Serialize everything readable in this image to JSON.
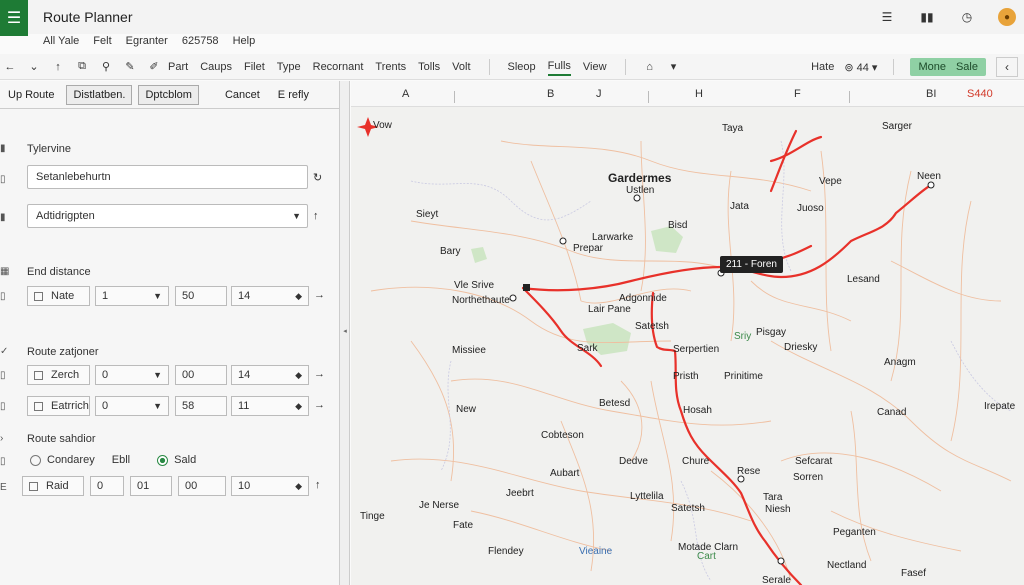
{
  "app": {
    "title": "Route Planner",
    "menu_icon": "hamburger-icon"
  },
  "menubar": [
    "All Yale",
    "Felt",
    "Egranter",
    "625758",
    "Help"
  ],
  "toolbar": {
    "labels": [
      "Part",
      "Caups",
      "Filet",
      "Type",
      "Recornant",
      "Trents",
      "Tolls",
      "Volt"
    ],
    "labels2": [
      "Sleop",
      "Fulls",
      "View"
    ],
    "active": "Fulls",
    "hate": "Hate",
    "zoom": "44",
    "green_label_1": "Mone",
    "green_label_2": "Sale"
  },
  "left": {
    "tabs": [
      "Up Route",
      "Distlatben.",
      "Dptcblom",
      "Cancet",
      "E refly"
    ],
    "section1": "Tylervine",
    "field1": "Setanlebehurtn",
    "field2": "Adtidrigpten",
    "section2": "End distance",
    "row1": {
      "label": "Nate",
      "v1": "1",
      "v2": "50",
      "v3": "14"
    },
    "section3": "Route zatjoner",
    "row2": {
      "label": "Zerch",
      "v1": "0",
      "v2": "00",
      "v3": "14"
    },
    "row3": {
      "label": "Eatrrich",
      "v1": "0",
      "v2": "58",
      "v3": "11"
    },
    "section4": "Route sahdior",
    "radio1": "Condarey",
    "radio_mid": "Ebll",
    "radio2": "Sald",
    "row4": {
      "label": "Raid",
      "v1": "0",
      "v2": "01",
      "v3": "00",
      "v4": "10"
    }
  },
  "map": {
    "columns": [
      "A",
      "B",
      "J",
      "H",
      "F",
      "BI"
    ],
    "price": "S440",
    "tooltip": "211 - Foren",
    "places": [
      {
        "t": "Vow",
        "c": ""
      },
      {
        "t": "Taya",
        "c": ""
      },
      {
        "t": "Sarger",
        "c": ""
      },
      {
        "t": "Gardermes",
        "c": "big"
      },
      {
        "t": "Ustlen",
        "c": ""
      },
      {
        "t": "Jata",
        "c": ""
      },
      {
        "t": "Vepe",
        "c": ""
      },
      {
        "t": "Juoso",
        "c": ""
      },
      {
        "t": "Neen",
        "c": ""
      },
      {
        "t": "Sieyt",
        "c": ""
      },
      {
        "t": "Bisd",
        "c": ""
      },
      {
        "t": "Larwarke",
        "c": ""
      },
      {
        "t": "Prepar",
        "c": ""
      },
      {
        "t": "Bary",
        "c": ""
      },
      {
        "t": "Vle Srive",
        "c": ""
      },
      {
        "t": "Northethaute",
        "c": ""
      },
      {
        "t": "Lesand",
        "c": ""
      },
      {
        "t": "Adgonnide",
        "c": ""
      },
      {
        "t": "Lair Pane",
        "c": ""
      },
      {
        "t": "Satetsh",
        "c": ""
      },
      {
        "t": "Sriy",
        "c": "green"
      },
      {
        "t": "Pisgay",
        "c": ""
      },
      {
        "t": "Driesky",
        "c": ""
      },
      {
        "t": "Missiee",
        "c": ""
      },
      {
        "t": "Sark",
        "c": ""
      },
      {
        "t": "Serpertien",
        "c": ""
      },
      {
        "t": "Anagm",
        "c": ""
      },
      {
        "t": "Pristh",
        "c": ""
      },
      {
        "t": "Prinitime",
        "c": ""
      },
      {
        "t": "New",
        "c": ""
      },
      {
        "t": "Betesd",
        "c": ""
      },
      {
        "t": "Hosah",
        "c": ""
      },
      {
        "t": "Canad",
        "c": ""
      },
      {
        "t": "Irepate",
        "c": ""
      },
      {
        "t": "Cobteson",
        "c": ""
      },
      {
        "t": "Dedve",
        "c": ""
      },
      {
        "t": "Chure",
        "c": ""
      },
      {
        "t": "Sefcarat",
        "c": ""
      },
      {
        "t": "Aubart",
        "c": ""
      },
      {
        "t": "Rese",
        "c": ""
      },
      {
        "t": "Sorren",
        "c": ""
      },
      {
        "t": "Jeebrt",
        "c": ""
      },
      {
        "t": "Lyttelila",
        "c": ""
      },
      {
        "t": "Tara",
        "c": ""
      },
      {
        "t": "Je Nerse",
        "c": ""
      },
      {
        "t": "Satetsh",
        "c": ""
      },
      {
        "t": "Niesh",
        "c": ""
      },
      {
        "t": "Tinge",
        "c": ""
      },
      {
        "t": "Fate",
        "c": ""
      },
      {
        "t": "Peganten",
        "c": ""
      },
      {
        "t": "Flendey",
        "c": ""
      },
      {
        "t": "Vieaine",
        "c": "blue"
      },
      {
        "t": "Motade Clarn",
        "c": ""
      },
      {
        "t": "Cart",
        "c": "green"
      },
      {
        "t": "Nectland",
        "c": ""
      },
      {
        "t": "Fasef",
        "c": ""
      },
      {
        "t": "Serale",
        "c": ""
      }
    ]
  }
}
